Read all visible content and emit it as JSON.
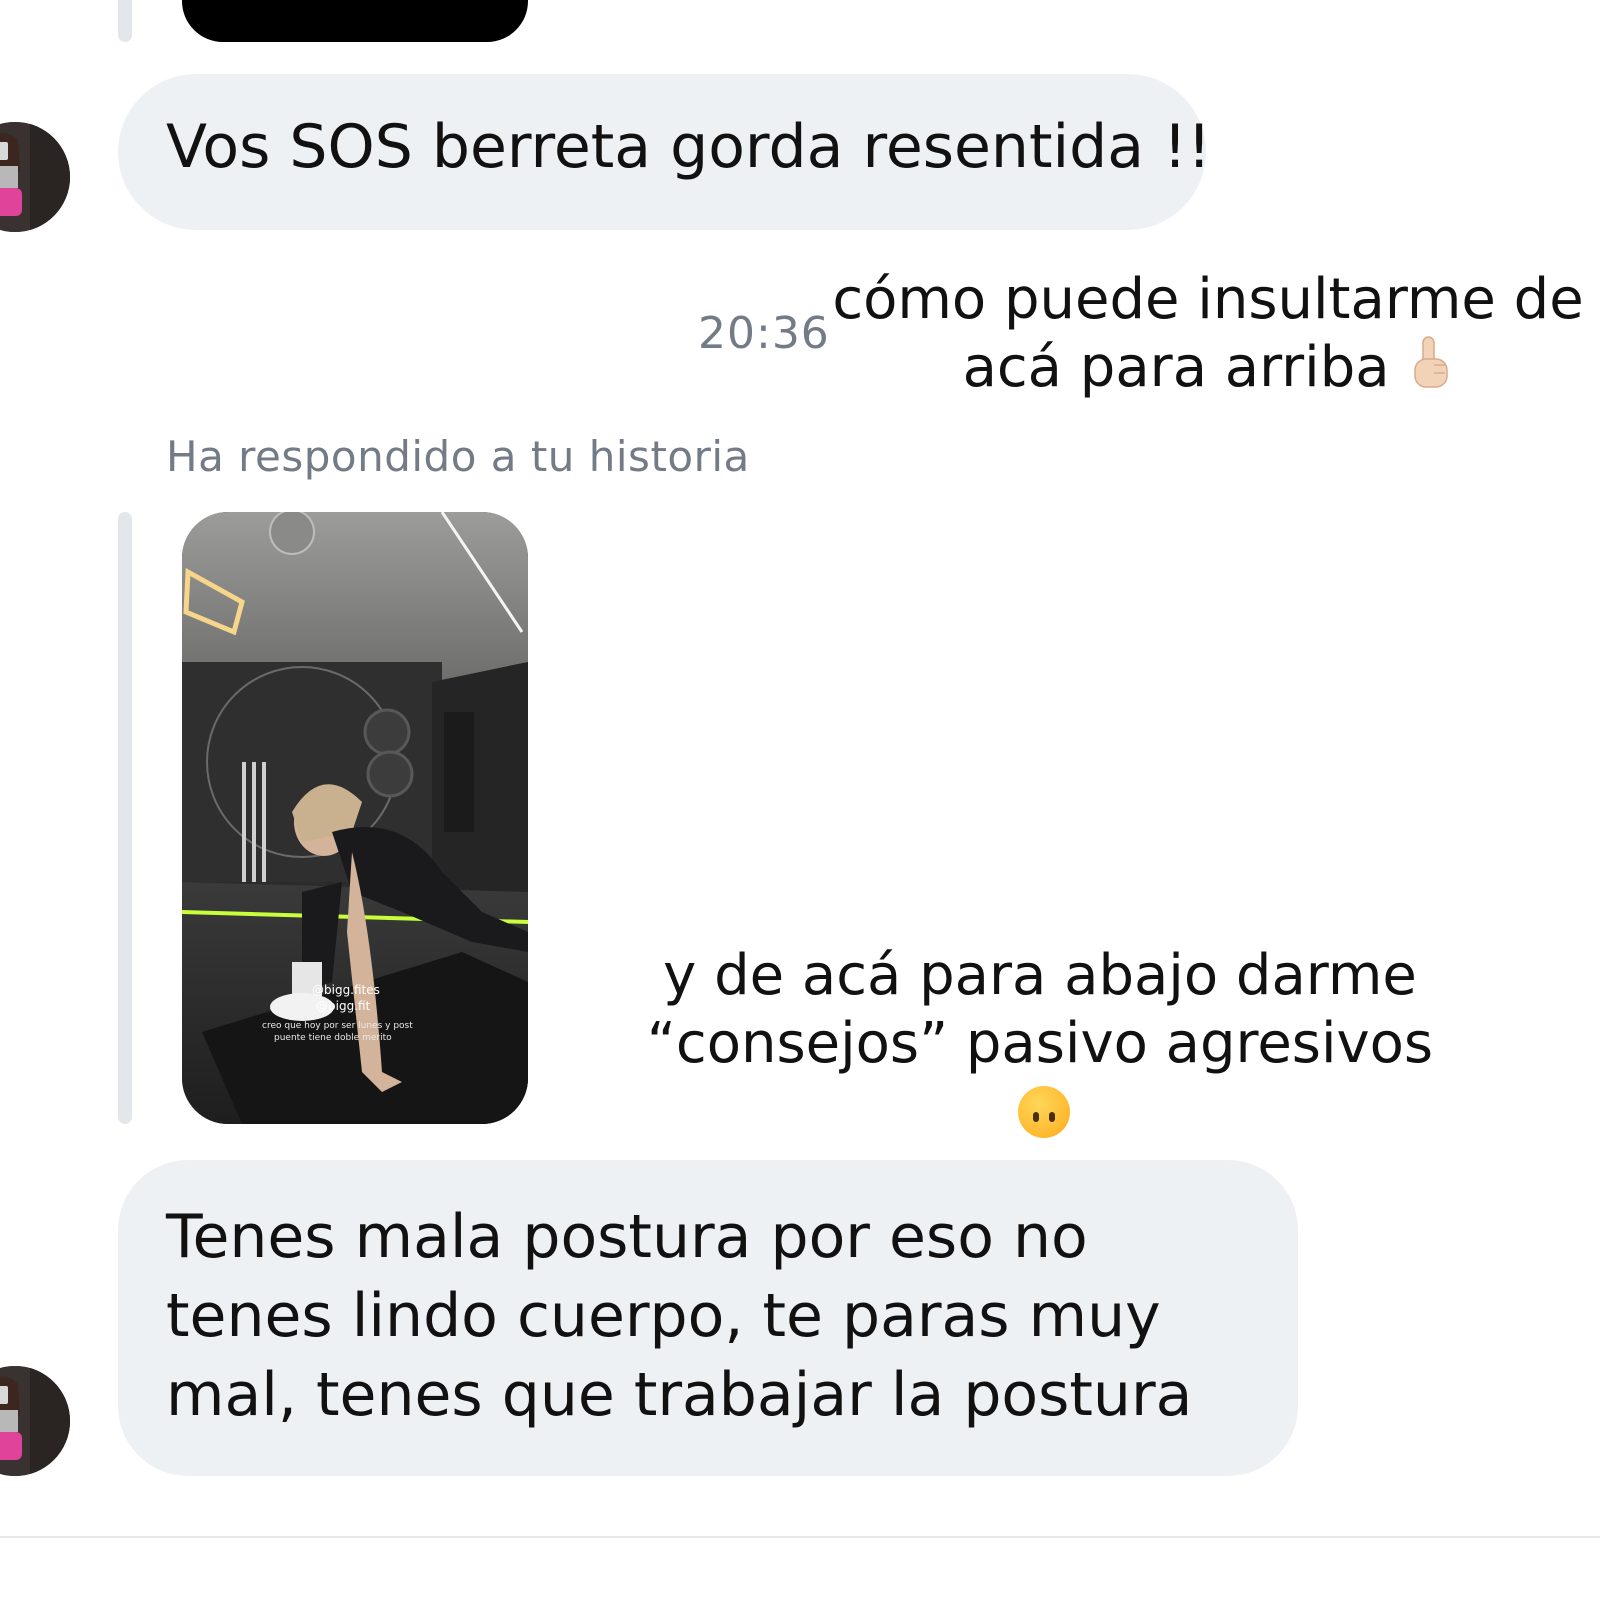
{
  "conversation": {
    "message_1": "Vos SOS berreta gorda resentida !!",
    "timestamp": "20:36",
    "caption_top_line1": "cómo puede insultarme de",
    "caption_top_line2": "acá para arriba",
    "caption_top_emoji": "pointing-up-icon",
    "reply_label": "Ha respondido a tu historia",
    "caption_bottom_line1": "y de acá para abajo darme",
    "caption_bottom_line2": "“consejos” pasivo agresivos",
    "caption_bottom_emoji": "upside-down-face-icon",
    "message_2": "Tenes mala postura por eso no tenes lindo cuerpo, te paras muy mal, tenes que trabajar la postura"
  },
  "story": {
    "handle_1": "@bigg.fites",
    "handle_2": "@bigg.fit",
    "caption_line1": "creo que hoy por ser lunes y post",
    "caption_line2": "puente tiene doble merito"
  },
  "colors": {
    "bubble_bg": "#eef1f4",
    "meta_text": "#737b86",
    "quote_bar": "#e3e6ea"
  }
}
